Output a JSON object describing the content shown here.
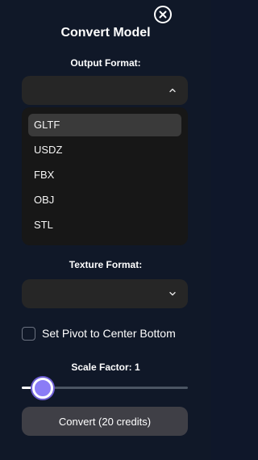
{
  "title": "Convert Model",
  "output_format": {
    "label": "Output Format:",
    "options": [
      "GLTF",
      "USDZ",
      "FBX",
      "OBJ",
      "STL"
    ],
    "highlighted": "GLTF"
  },
  "texture_format": {
    "label": "Texture Format:"
  },
  "pivot_option": {
    "label": "Set Pivot to Center Bottom",
    "checked": false
  },
  "scale": {
    "label": "Scale Factor: 1",
    "value": 1
  },
  "convert_button": {
    "label": "Convert (20 credits)"
  },
  "colors": {
    "background": "#101828",
    "field": "#262626",
    "dropdown": "#171717",
    "accent": "#8b7cf6",
    "button": "#3f3f46"
  }
}
